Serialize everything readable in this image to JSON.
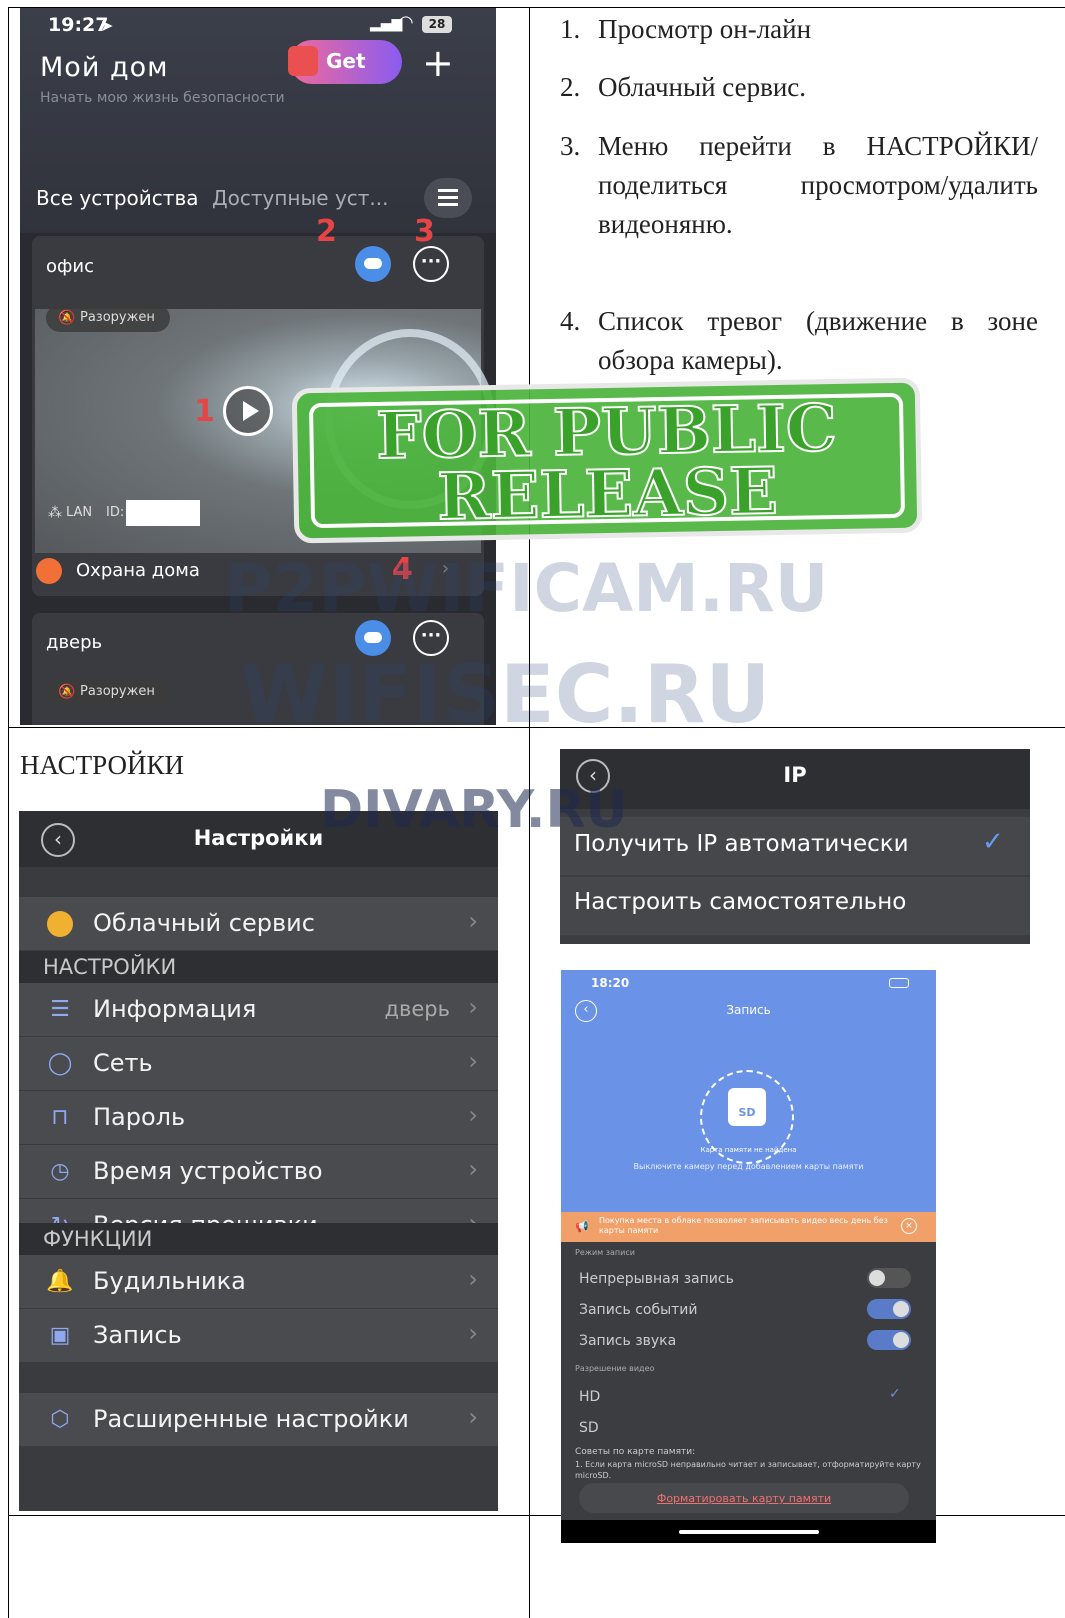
{
  "phone_home": {
    "time": "19:27",
    "battery": "28",
    "title": "Мой дом",
    "subtitle": "Начать мою жизнь безопасности",
    "promo_button": "Get",
    "tab_all": "Все устройства",
    "tab_available": "Доступные уст...",
    "device1_name": "офис",
    "device1_status": "Разоружен",
    "device1_conn": "LAN",
    "device1_id_label": "ID:",
    "marker1": "1",
    "marker2": "2",
    "marker3": "3",
    "marker4": "4",
    "security_label": "Охрана дома",
    "device2_name": "дверь",
    "device2_status": "Разоружен"
  },
  "instructions": [
    {
      "num": "1.",
      "text": "Просмотр он-лайн"
    },
    {
      "num": "2.",
      "text": "Облачный сервис."
    },
    {
      "num": "3.",
      "text": "Меню перейти в НАСТРОЙКИ/поделиться просмотром/удалить видеоняню."
    },
    {
      "num": "4.",
      "text": "Список тревог (движение в зоне обзора камеры)."
    }
  ],
  "stamp": {
    "line1": "FOR PUBLIC",
    "line2": "RELEASE"
  },
  "watermarks": {
    "w1": "P2PWIFICAM.RU",
    "w2": "WIFISEC.RU",
    "w3": "DIVARY.RU"
  },
  "section_label": "НАСТРОЙКИ",
  "settings": {
    "title": "Настройки",
    "cloud": "Облачный сервис",
    "group1": "НАСТРОЙКИ",
    "info": "Информация",
    "info_value": "дверь",
    "network": "Сеть",
    "password": "Пароль",
    "time": "Время устройство",
    "firmware": "Версия прошивки",
    "group2": "ФУНКЦИИ",
    "alarm": "Будильника",
    "record": "Запись",
    "advanced": "Расширенные настройки"
  },
  "ip_panel": {
    "title": "IP",
    "auto": "Получить IP автоматически",
    "manual": "Настроить самостоятельно"
  },
  "record_panel": {
    "time": "18:20",
    "title": "Запись",
    "sd": "SD",
    "not_found": "Карта памяти не найдена",
    "hint": "Выключите камеру перед добавлением карты памяти",
    "banner": "Покупка места в облаке позволяет записывать видео весь день без карты памяти",
    "mode_header": "Режим записи",
    "continuous": "Непрерывная запись",
    "events": "Запись событий",
    "sound": "Запись звука",
    "res_header": "Разрешение видео",
    "hd": "HD",
    "sd_res": "SD",
    "tips_title": "Советы по карте памяти:",
    "tips_text": "1. Если карта microSD неправильно читает и записывает, отформатируйте карту microSD.",
    "format": "Форматировать карту памяти"
  }
}
